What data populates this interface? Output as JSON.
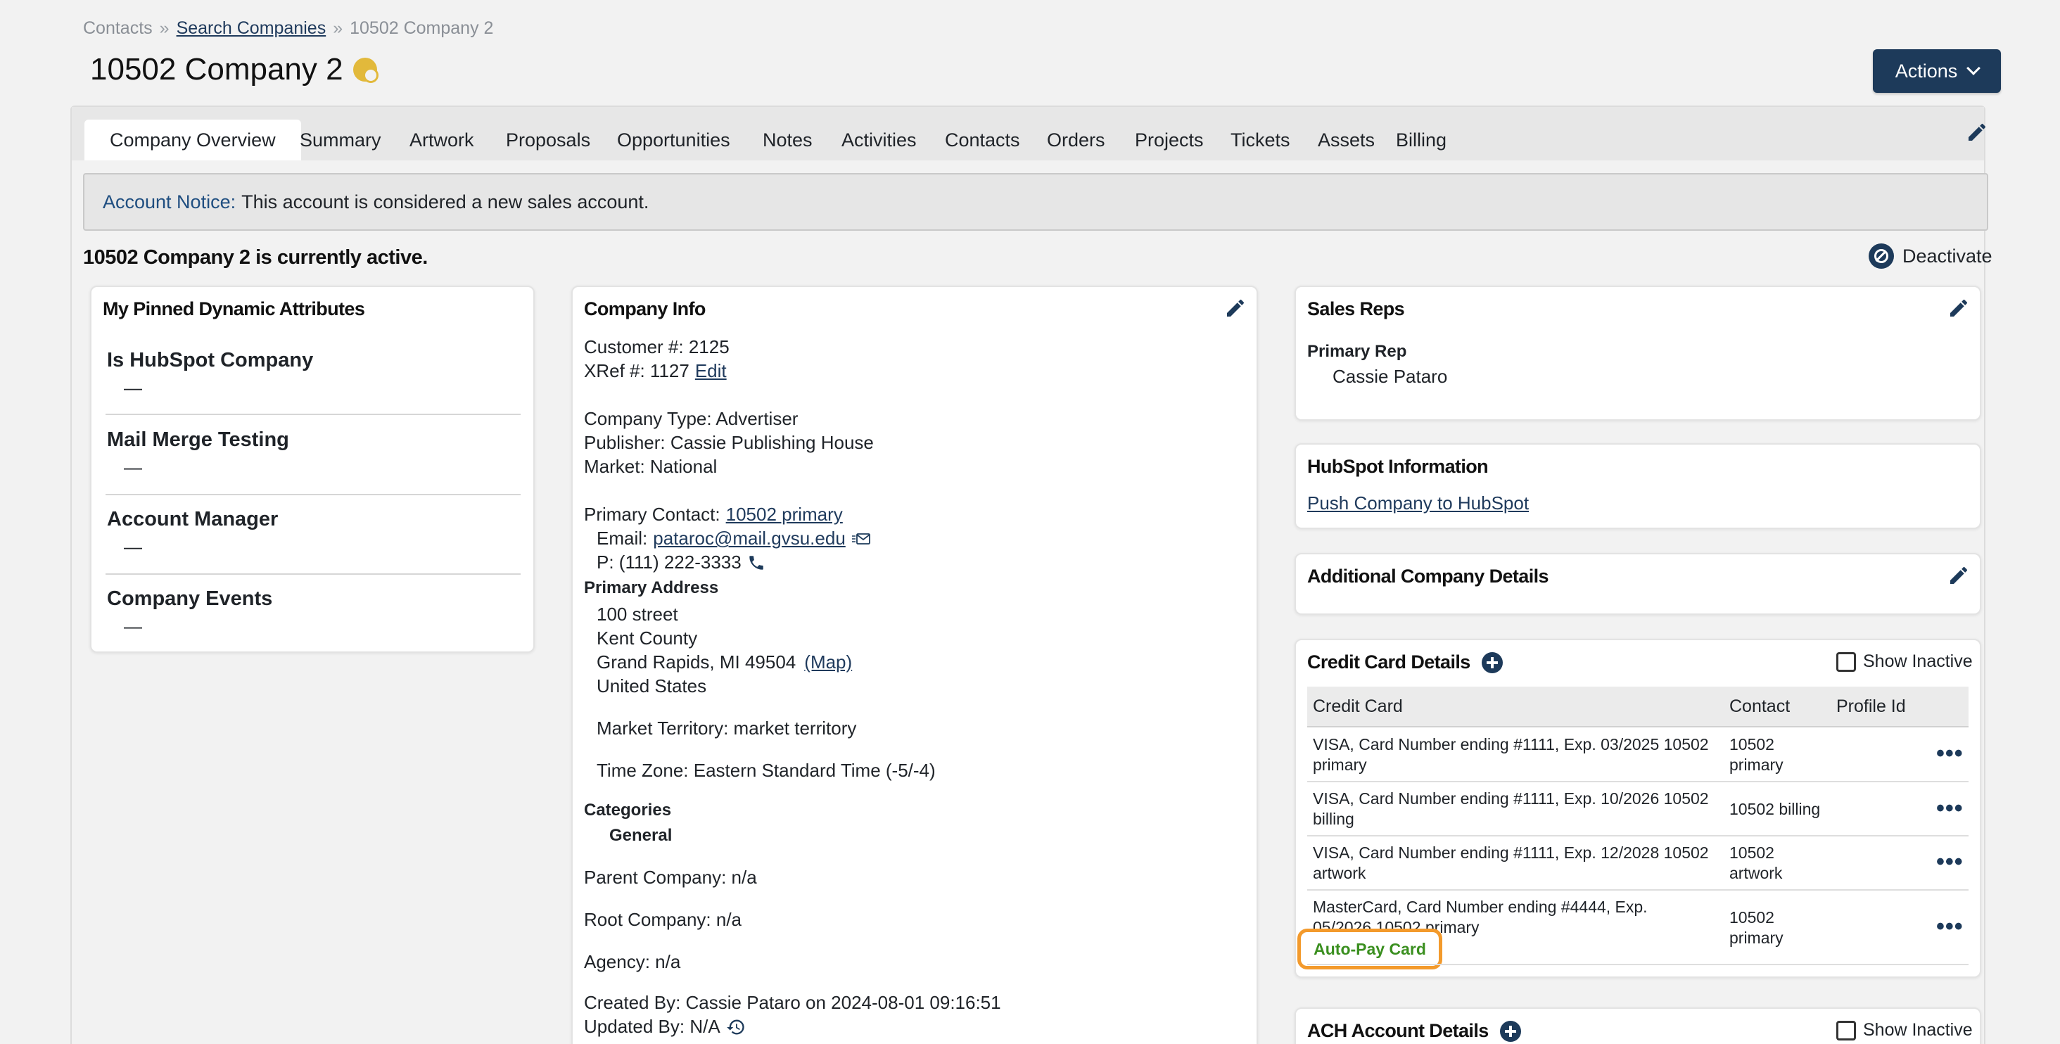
{
  "breadcrumb": {
    "item1": "Contacts",
    "sep": "»",
    "item2": "Search Companies",
    "item3": "10502 Company 2"
  },
  "page": {
    "title": "10502 Company 2",
    "actions_label": "Actions"
  },
  "tabs": [
    "Company Overview",
    "Summary",
    "Artwork",
    "Proposals",
    "Opportunities",
    "Notes",
    "Activities",
    "Contacts",
    "Orders",
    "Projects",
    "Tickets",
    "Assets",
    "Billing"
  ],
  "notice": {
    "label": "Account Notice:",
    "text": "This account is considered a new sales account."
  },
  "status": {
    "text": "10502 Company 2 is currently active.",
    "deactivate_label": "Deactivate"
  },
  "pinned": {
    "title": "My Pinned Dynamic Attributes",
    "items": [
      {
        "label": "Is HubSpot Company",
        "value": "—"
      },
      {
        "label": "Mail Merge Testing",
        "value": "—"
      },
      {
        "label": "Account Manager",
        "value": "—"
      },
      {
        "label": "Company Events",
        "value": "—"
      }
    ]
  },
  "company_info": {
    "title": "Company Info",
    "customer": "Customer #: 2125",
    "xref": "XRef #: 1127",
    "xref_edit": "Edit",
    "company_type": "Company Type: Advertiser",
    "publisher": "Publisher: Cassie Publishing House",
    "market": "Market: National",
    "primary_contact_label": "Primary Contact:",
    "primary_contact_link": "10502 primary",
    "email_label": "Email:",
    "email": "pataroc@mail.gvsu.edu",
    "phone": "P: (111) 222-3333",
    "address_heading": "Primary Address",
    "address_line1": "100 street",
    "address_line2": "Kent County",
    "address_line3": "Grand Rapids, MI 49504",
    "map_link": "(Map)",
    "address_line4": "United States",
    "territory": "Market Territory: market territory",
    "timezone": "Time Zone: Eastern Standard Time (-5/-4)",
    "categories_heading": "Categories",
    "category": "General",
    "parent": "Parent Company: n/a",
    "root": "Root Company: n/a",
    "agency": "Agency: n/a",
    "created": "Created By: Cassie Pataro on 2024-08-01 09:16:51",
    "updated": "Updated By: N/A"
  },
  "sales_reps": {
    "title": "Sales Reps",
    "primary_label": "Primary Rep",
    "primary_name": "Cassie Pataro"
  },
  "hubspot": {
    "title": "HubSpot Information",
    "push_link": "Push Company to HubSpot"
  },
  "additional": {
    "title": "Additional Company Details"
  },
  "credit_cards": {
    "title": "Credit Card Details",
    "show_inactive": "Show Inactive",
    "headers": [
      "Credit Card",
      "Contact",
      "Profile Id"
    ],
    "rows": [
      {
        "card_l1": "VISA, Card Number ending #1111, Exp. 03/2025 10502",
        "card_l2": "primary",
        "contact_l1": "10502",
        "contact_l2": "primary",
        "more": "•••"
      },
      {
        "card_l1": "VISA, Card Number ending #1111, Exp. 10/2026 10502",
        "card_l2": "billing",
        "contact_l1": "10502 billing",
        "contact_l2": "",
        "more": "•••"
      },
      {
        "card_l1": "VISA, Card Number ending #1111, Exp. 12/2028 10502",
        "card_l2": "artwork",
        "contact_l1": "10502",
        "contact_l2": "artwork",
        "more": "•••"
      },
      {
        "card_l1": "MasterCard, Card Number ending #4444, Exp.",
        "card_l2": "05/2026 10502 primary",
        "contact_l1": "10502",
        "contact_l2": "primary",
        "more": "•••",
        "badge": "Auto-Pay Card"
      }
    ]
  },
  "ach": {
    "title": "ACH Account Details",
    "show_inactive": "Show Inactive"
  }
}
